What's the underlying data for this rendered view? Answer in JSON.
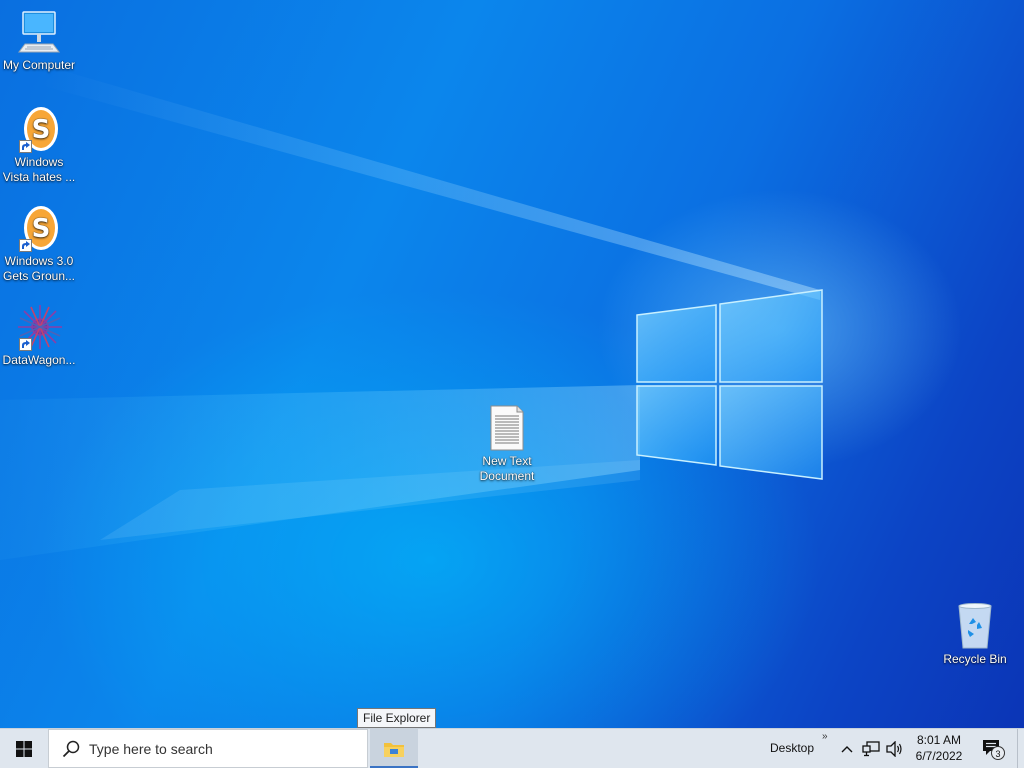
{
  "desktop": {
    "icons": [
      {
        "label": "My Computer",
        "icon": "computer-icon"
      },
      {
        "label": "Windows\nVista hates ...",
        "icon": "scratch-app-icon",
        "shortcut": true
      },
      {
        "label": "Windows 3.0\nGets Groun...",
        "icon": "scratch-app-icon",
        "shortcut": true
      },
      {
        "label": "DataWagon...",
        "icon": "datawagon-app-icon",
        "shortcut": true
      },
      {
        "label": "New Text\nDocument",
        "icon": "text-document-icon"
      },
      {
        "label": "Recycle Bin",
        "icon": "recycle-bin-icon"
      }
    ]
  },
  "taskbar": {
    "start_icon": "windows-logo-icon",
    "search_placeholder": "Type here to search",
    "pinned": [
      {
        "name": "File Explorer",
        "icon": "folder-icon",
        "active": true
      }
    ],
    "tooltip": "File Explorer",
    "toolbar_label": "Desktop",
    "toolbar_chevron": "»",
    "tray_icons": [
      "chevron-up-icon",
      "network-icon",
      "volume-icon"
    ],
    "clock": {
      "time": "8:01 AM",
      "date": "6/7/2022"
    },
    "notification_count": "3"
  },
  "colors": {
    "desktop_accent": "#0b78e6",
    "taskbar_bg": "#dfe6ee"
  }
}
